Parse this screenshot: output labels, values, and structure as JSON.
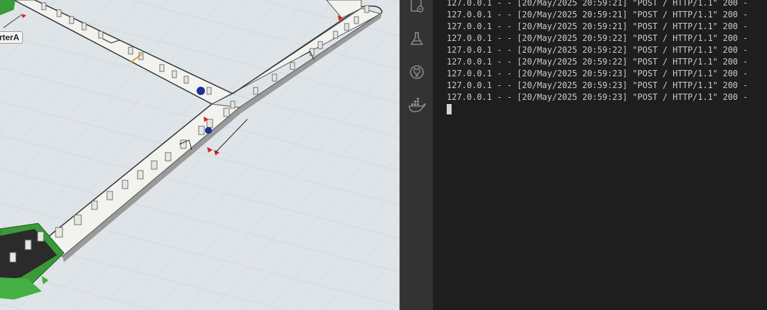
{
  "simulation": {
    "object_label": "rterA"
  },
  "activity_bar": {
    "items": [
      {
        "icon": "remote-explorer-icon"
      },
      {
        "icon": "flask-test-icon"
      },
      {
        "icon": "github-icon"
      },
      {
        "icon": "docker-icon"
      }
    ]
  },
  "terminal": {
    "lines": [
      "127.0.0.1 - - [20/May/2025 20:59:21] \"POST / HTTP/1.1\" 200 -",
      "127.0.0.1 - - [20/May/2025 20:59:21] \"POST / HTTP/1.1\" 200 -",
      "127.0.0.1 - - [20/May/2025 20:59:21] \"POST / HTTP/1.1\" 200 -",
      "127.0.0.1 - - [20/May/2025 20:59:22] \"POST / HTTP/1.1\" 200 -",
      "127.0.0.1 - - [20/May/2025 20:59:22] \"POST / HTTP/1.1\" 200 -",
      "127.0.0.1 - - [20/May/2025 20:59:22] \"POST / HTTP/1.1\" 200 -",
      "127.0.0.1 - - [20/May/2025 20:59:23] \"POST / HTTP/1.1\" 200 -",
      "127.0.0.1 - - [20/May/2025 20:59:23] \"POST / HTTP/1.1\" 200 -",
      "127.0.0.1 - - [20/May/2025 20:59:23] \"POST / HTTP/1.1\" 200 -"
    ]
  }
}
